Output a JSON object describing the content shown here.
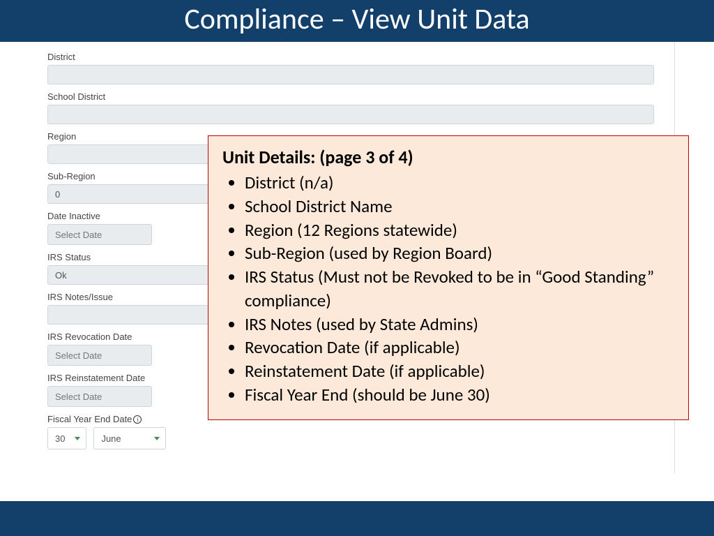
{
  "header": {
    "title": "Compliance – View Unit Data"
  },
  "form": {
    "district": {
      "label": "District",
      "value": ""
    },
    "school_district": {
      "label": "School District",
      "value": ""
    },
    "region": {
      "label": "Region",
      "value": ""
    },
    "sub_region": {
      "label": "Sub-Region",
      "value": "0"
    },
    "date_inactive": {
      "label": "Date Inactive",
      "placeholder": "Select Date"
    },
    "irs_status": {
      "label": "IRS Status",
      "value": "Ok"
    },
    "irs_notes": {
      "label": "IRS Notes/Issue",
      "value": ""
    },
    "irs_revocation": {
      "label": "IRS Revocation Date",
      "placeholder": "Select Date"
    },
    "irs_reinstatement": {
      "label": "IRS Reinstatement Date",
      "placeholder": "Select Date"
    },
    "fiscal_year_end": {
      "label": "Fiscal Year End Date",
      "day": "30",
      "month": "June"
    }
  },
  "callout": {
    "title": "Unit Details: (page 3 of 4)",
    "items": [
      "District (n/a)",
      "School District Name",
      "Region (12 Regions statewide)",
      "Sub-Region (used by Region Board)",
      "IRS Status (Must not be Revoked to be in “Good Standing” compliance)",
      "IRS Notes (used by State Admins)",
      "Revocation Date (if applicable)",
      "Reinstatement Date (if applicable)",
      "Fiscal Year End (should be June 30)"
    ]
  }
}
